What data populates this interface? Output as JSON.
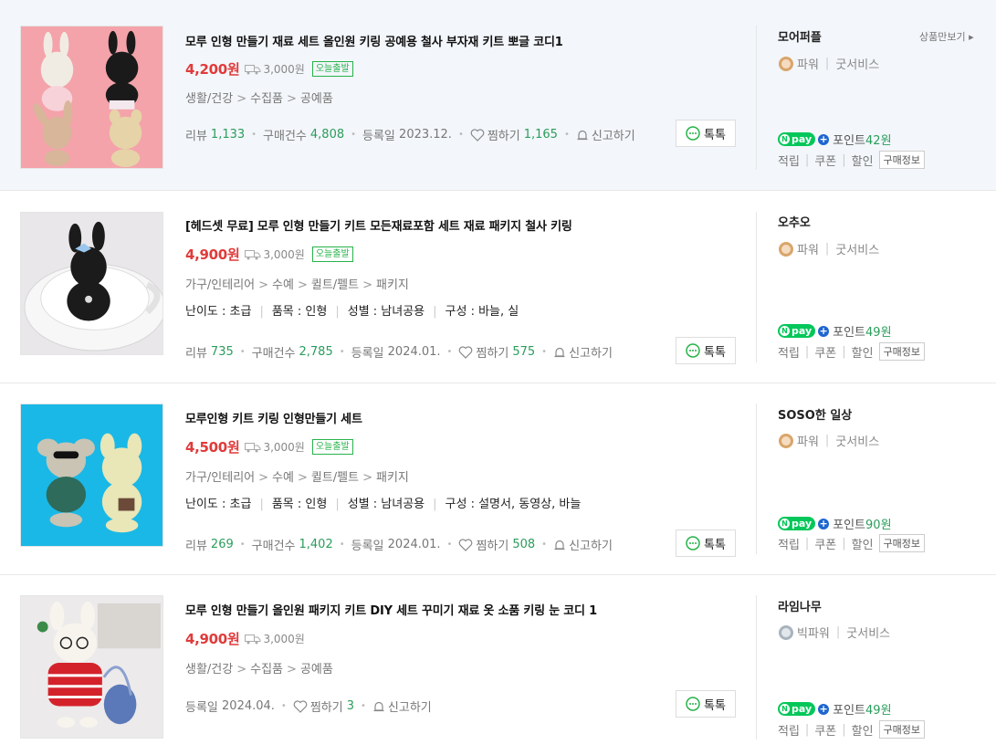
{
  "more_label": "상품만보기",
  "colors": {
    "price": "#e03b3b",
    "green": "#2a9d5c",
    "npay": "#03c75a"
  },
  "products": [
    {
      "title": "모루 인형 만들기 재료 세트 올인원 키링 공예용 철사 부자재 키트 뽀글 코디1",
      "price": "4,200원",
      "shipping": "3,000원",
      "badge": "오늘출발",
      "category": [
        "생활/건강",
        "수집품",
        "공예품"
      ],
      "attrs": [],
      "review_label": "리뷰",
      "review_count": "1,133",
      "purchase_label": "구매건수",
      "purchase_count": "4,808",
      "date_label": "등록일",
      "date": "2023.12.",
      "like_label": "찜하기",
      "like_count": "1,165",
      "report_label": "신고하기",
      "talk_label": "톡톡",
      "seller": "모어퍼플",
      "grade": "파워",
      "service": "굿서비스",
      "npay_label": "pay",
      "point_label": "포인트",
      "point": "42원",
      "benefits": [
        "적립",
        "쿠폰",
        "할인"
      ],
      "purchase_info": "구매정보"
    },
    {
      "title": "[헤드셋 무료] 모루 인형 만들기 키트 모든재료포함 세트 재료 패키지 철사 키링",
      "price": "4,900원",
      "shipping": "3,000원",
      "badge": "오늘출발",
      "category": [
        "가구/인테리어",
        "수예",
        "퀼트/펠트",
        "패키지"
      ],
      "attrs": [
        "난이도 : 초급",
        "품목 : 인형",
        "성별 : 남녀공용",
        "구성 : 바늘, 실"
      ],
      "review_label": "리뷰",
      "review_count": "735",
      "purchase_label": "구매건수",
      "purchase_count": "2,785",
      "date_label": "등록일",
      "date": "2024.01.",
      "like_label": "찜하기",
      "like_count": "575",
      "report_label": "신고하기",
      "talk_label": "톡톡",
      "seller": "오추오",
      "grade": "파워",
      "service": "굿서비스",
      "npay_label": "pay",
      "point_label": "포인트",
      "point": "49원",
      "benefits": [
        "적립",
        "쿠폰",
        "할인"
      ],
      "purchase_info": "구매정보"
    },
    {
      "title": "모루인형 키트 키링 인형만들기 세트",
      "price": "4,500원",
      "shipping": "3,000원",
      "badge": "오늘출발",
      "category": [
        "가구/인테리어",
        "수예",
        "퀼트/펠트",
        "패키지"
      ],
      "attrs": [
        "난이도 : 초급",
        "품목 : 인형",
        "성별 : 남녀공용",
        "구성 : 설명서, 동영상, 바늘"
      ],
      "review_label": "리뷰",
      "review_count": "269",
      "purchase_label": "구매건수",
      "purchase_count": "1,402",
      "date_label": "등록일",
      "date": "2024.01.",
      "like_label": "찜하기",
      "like_count": "508",
      "report_label": "신고하기",
      "talk_label": "톡톡",
      "seller": "SOSO한 일상",
      "grade": "파워",
      "service": "굿서비스",
      "npay_label": "pay",
      "point_label": "포인트",
      "point": "90원",
      "benefits": [
        "적립",
        "쿠폰",
        "할인"
      ],
      "purchase_info": "구매정보"
    },
    {
      "title": "모루 인형 만들기 올인원 패키지 키트 DIY 세트 꾸미기 재료 옷 소품 키링 눈 코디 1",
      "price": "4,900원",
      "shipping": "3,000원",
      "badge": "",
      "category": [
        "생활/건강",
        "수집품",
        "공예품"
      ],
      "attrs": [],
      "date_label": "등록일",
      "date": "2024.04.",
      "like_label": "찜하기",
      "like_count": "3",
      "report_label": "신고하기",
      "talk_label": "톡톡",
      "seller": "라임나무",
      "grade": "빅파워",
      "service": "굿서비스",
      "npay_label": "pay",
      "point_label": "포인트",
      "point": "49원",
      "benefits": [
        "적립",
        "쿠폰",
        "할인"
      ],
      "purchase_info": "구매정보"
    }
  ]
}
